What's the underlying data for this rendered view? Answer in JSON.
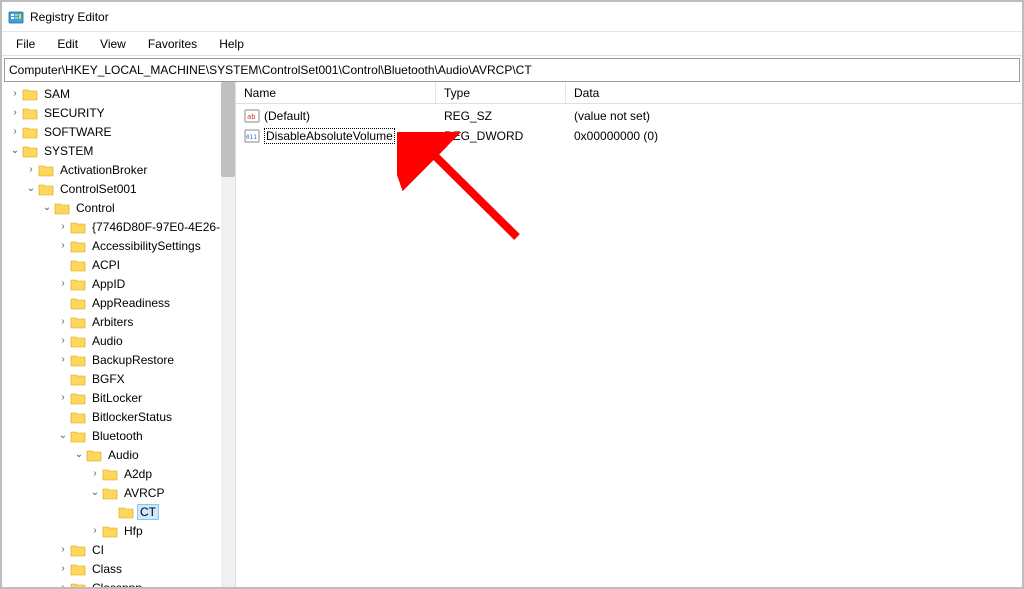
{
  "app": {
    "title": "Registry Editor"
  },
  "menu": {
    "file": "File",
    "edit": "Edit",
    "view": "View",
    "favorites": "Favorites",
    "help": "Help"
  },
  "address": "Computer\\HKEY_LOCAL_MACHINE\\SYSTEM\\ControlSet001\\Control\\Bluetooth\\Audio\\AVRCP\\CT",
  "columns": {
    "name": "Name",
    "type": "Type",
    "data": "Data"
  },
  "values": [
    {
      "name": "(Default)",
      "type": "REG_SZ",
      "data": "(value not set)",
      "icon": "sz"
    },
    {
      "name": "DisableAbsoluteVolume",
      "type": "REG_DWORD",
      "data": "0x00000000 (0)",
      "icon": "dword",
      "renaming": true
    }
  ],
  "tree": {
    "sam": "SAM",
    "security": "SECURITY",
    "software": "SOFTWARE",
    "system": "SYSTEM",
    "activationBroker": "ActivationBroker",
    "controlSet001": "ControlSet001",
    "control": "Control",
    "guidKey": "{7746D80F-97E0-4E26-",
    "accessibility": "AccessibilitySettings",
    "acpi": "ACPI",
    "appid": "AppID",
    "appreadiness": "AppReadiness",
    "arbiters": "Arbiters",
    "audio": "Audio",
    "backuprestore": "BackupRestore",
    "bgfx": "BGFX",
    "bitlocker": "BitLocker",
    "bitlockerstatus": "BitlockerStatus",
    "bluetooth": "Bluetooth",
    "bt_audio": "Audio",
    "a2dp": "A2dp",
    "avrcp": "AVRCP",
    "ct": "CT",
    "hfp": "Hfp",
    "ci": "CI",
    "class": "Class",
    "classpnp": "Classpnp"
  }
}
